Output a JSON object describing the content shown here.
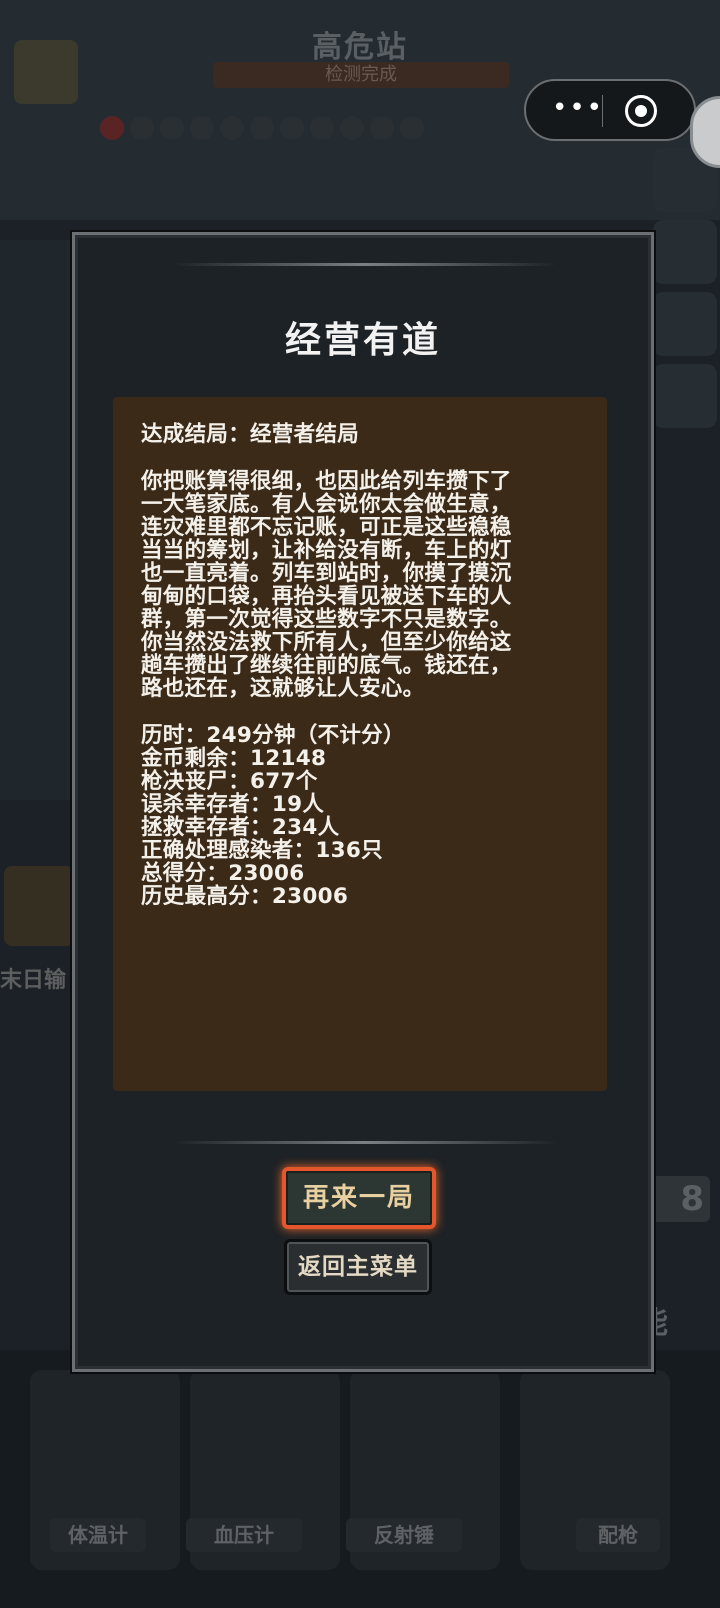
{
  "background": {
    "station_title": "高危站",
    "station_status": "检测完成",
    "left_partial_label": "末日输",
    "right_partial_number": "8",
    "right_partial_char": "能",
    "tools": [
      {
        "label": "体温计",
        "icon": "thermometer-icon"
      },
      {
        "label": "血压计",
        "icon": "blood-pressure-monitor-icon"
      },
      {
        "label": "反射锤",
        "icon": "reflex-hammer-icon"
      },
      {
        "label": "配枪",
        "icon": "pistol-icon"
      }
    ]
  },
  "capsule": {
    "more_label": "•••",
    "more_icon": "more-dots-icon",
    "close_icon": "target-close-icon"
  },
  "dialog": {
    "title": "经营有道",
    "ending_line": "达成结局：经营者结局",
    "story_lines": [
      "你把账算得很细，也因此给列车攒下了",
      "一大笔家底。有人会说你太会做生意，",
      "连灾难里都不忘记账，可正是这些稳稳",
      "当当的筹划，让补给没有断，车上的灯",
      "也一直亮着。列车到站时，你摸了摸沉",
      "甸甸的口袋，再抬头看见被送下车的人",
      "群，第一次觉得这些数字不只是数字。",
      "你当然没法救下所有人，但至少你给这",
      "趟车攒出了继续往前的底气。钱还在，",
      "路也还在，这就够让人安心。"
    ],
    "stats": [
      {
        "label": "历时：",
        "value": "249分钟（不计分）"
      },
      {
        "label": "金币剩余：",
        "value": "12148"
      },
      {
        "label": "枪决丧尸：",
        "value": "677个"
      },
      {
        "label": "误杀幸存者：",
        "value": "19人"
      },
      {
        "label": "拯救幸存者：",
        "value": "234人"
      },
      {
        "label": "正确处理感染者：",
        "value": "136只"
      },
      {
        "label": "总得分：",
        "value": "23006"
      },
      {
        "label": "历史最高分：",
        "value": "23006"
      }
    ],
    "play_again_label": "再来一局",
    "main_menu_label": "返回主菜单"
  },
  "colors": {
    "dialog_bg": "#1d2226",
    "story_bg": "#3c2a19",
    "highlight_border": "#e4562c",
    "button_text": "#e8d0a0"
  }
}
